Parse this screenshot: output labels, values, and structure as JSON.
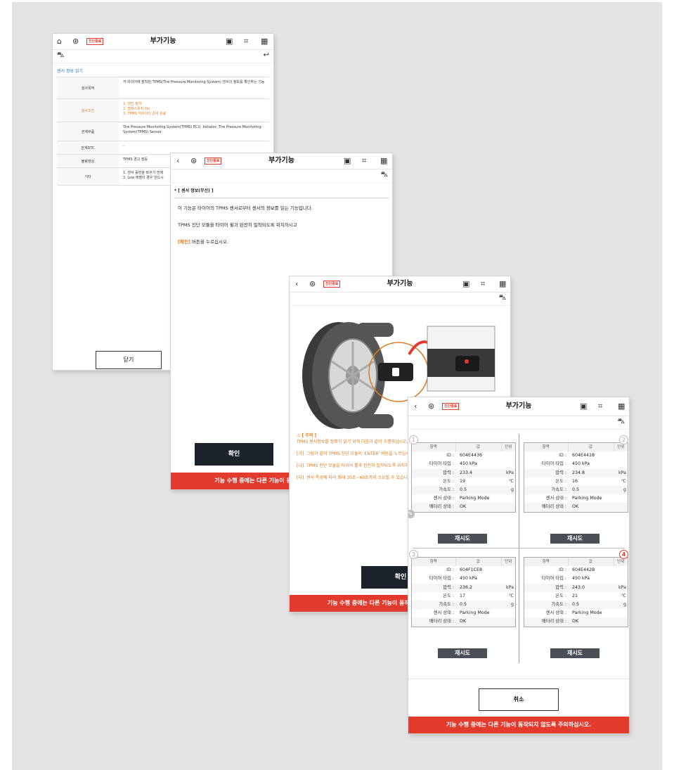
{
  "screen1": {
    "title": "부가기능",
    "status_tag": "진단종료",
    "section_label": "센서 정보 읽기",
    "rows": [
      {
        "key": "검사목적",
        "value": "각 타이어에 장착된 TPMS(Tire Pressure Monitoring System) 센서의 정보를 확인하는 기능"
      },
      {
        "key": "검사조건",
        "value": "1. 엔진 정지\n2. 점화스위치 On\n3. TPMS 익사이터 준비 완료"
      },
      {
        "key": "관계부품",
        "value": "Tire Pressure Monitoring System(TPMS) ECU, Initiator, Tire Pressure Monitoring System(TPMS) Sensor"
      },
      {
        "key": "관계DTC",
        "value": "-"
      },
      {
        "key": "불량현상",
        "value": "TPMS 경고 점등"
      },
      {
        "key": "기타",
        "value": "1. 센서 홀번을 바꾸기 전에\n2. Low 레벨이 경우 반드시"
      }
    ],
    "close_button": "닫기"
  },
  "screen2": {
    "title": "부가기능",
    "status_tag": "진단종료",
    "heading": "* [ 센서 정보(무선) ]",
    "line1": "이 기능은 타이어의 TPMS 센서로부터 센서의 정보를 읽는 기능입니다.",
    "line2": "TPMS 진단 모듈을 타이어 휠과 완전히 밀착되도록 위치하시고",
    "line3_highlight": "[확인]",
    "line3_rest": " 버튼을 누르십시오.",
    "confirm_button": "확인",
    "footer": "기능 수행 중에는 다른 기능이 동작되지 않도록 주의하십시오."
  },
  "screen3": {
    "title": "부가기능",
    "status_tag": "진단종료",
    "caution_title": "⚠ [ 주의 ]",
    "caution1": "TPMS 센서정보를 정확히 읽기 위해 다음과 같이 수행하십시오.",
    "caution2": "[가]. 그림과 같이 TPMS 진단 모듈의 'ENTER' 버튼을 누르십시오.",
    "caution3": "[나]. TPMS 진단 모듈을 타이어 휠과 완전히 밀착되도록 위치하십시오.",
    "caution4": "[다]. 센서 특성에 따라 최대 30초~60초까지 소요될 수 있습니다.",
    "confirm_button": "확인",
    "footer": "기능 수행 중에는 다른 기능이 동작되지 않도록 주의하십시오."
  },
  "screen4": {
    "title": "부가기능",
    "status_tag": "진단종료",
    "headers": [
      "항목",
      "값",
      "단위"
    ],
    "labels": [
      "ID :",
      "타이어 타입 :",
      "압력 :",
      "온도 :",
      "가속도 :",
      "센서 상태 :",
      "배터리 상태 :"
    ],
    "units": [
      "",
      "",
      "kPa",
      "℃",
      "g",
      "",
      ""
    ],
    "panels": [
      {
        "num": "1",
        "values": [
          "604E4436",
          "450 kPa",
          "233.4",
          "19",
          "0.5",
          "Parking Mode",
          "OK"
        ]
      },
      {
        "num": "2",
        "values": [
          "604E4418",
          "450 kPa",
          "234.8",
          "16",
          "0.5",
          "Parking Mode",
          "OK"
        ]
      },
      {
        "num": "3",
        "values": [
          "604F1CE8",
          "450 kPa",
          "236.2",
          "17",
          "0.5",
          "Parking Mode",
          "OK"
        ]
      },
      {
        "num": "4",
        "values": [
          "604E442B",
          "450 kPa",
          "243.0",
          "21",
          "0.5",
          "Parking Mode",
          "OK"
        ]
      }
    ],
    "retry_button": "재시도",
    "cancel_button": "취소",
    "footer": "기능 수행 중에는 다른 기능이 동작되지 않도록 주의하십시오."
  },
  "colors": {
    "accent_red": "#e23b2e",
    "orange_text": "#e07a1f",
    "dark_button": "#1c2229",
    "canvas": "#e3e3e3"
  }
}
